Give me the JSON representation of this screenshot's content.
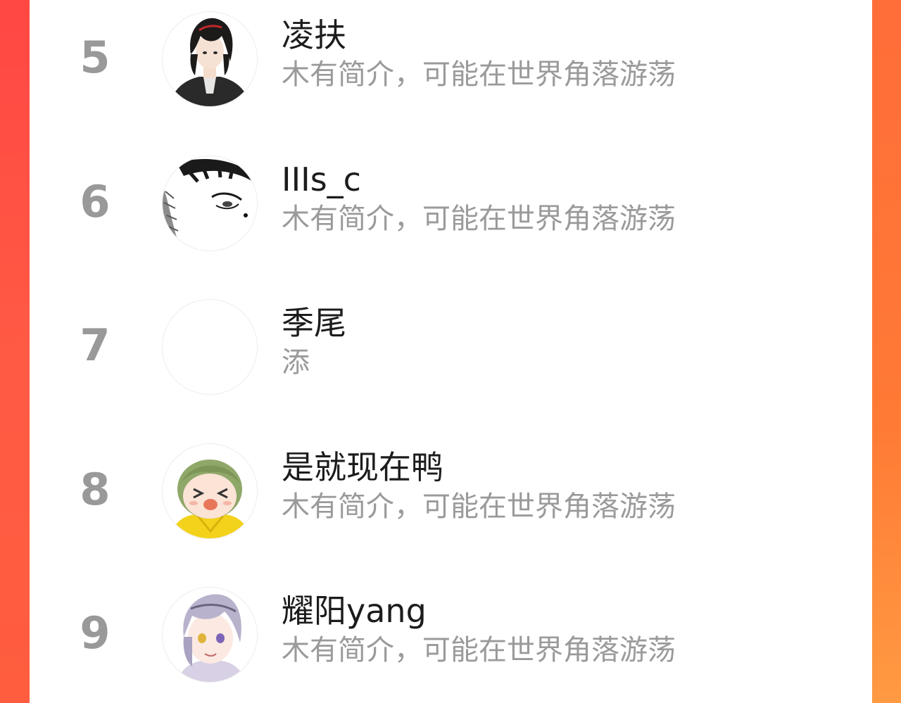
{
  "list": {
    "items": [
      {
        "rank": "5",
        "name": "凌扶",
        "bio": "木有简介，可能在世界角落游荡",
        "avatar_icon": "dark-haired-boy-avatar-icon"
      },
      {
        "rank": "6",
        "name": "IIIs_c",
        "bio": "木有简介，可能在世界角落游荡",
        "avatar_icon": "manga-eye-avatar-icon"
      },
      {
        "rank": "7",
        "name": "季尾",
        "bio": "添",
        "avatar_icon": "blank-avatar-icon"
      },
      {
        "rank": "8",
        "name": "是就现在鸭",
        "bio": "木有简介，可能在世界角落游荡",
        "avatar_icon": "green-hair-chibi-avatar-icon"
      },
      {
        "rank": "9",
        "name": "耀阳yang",
        "bio": "木有简介，可能在世界角落游荡",
        "avatar_icon": "silver-hair-boy-avatar-icon"
      }
    ]
  },
  "colors": {
    "background_gradient_start": "#ff4a4a",
    "background_gradient_end": "#ff7a35",
    "rank_text": "#999999",
    "name_text": "#1c1c1c",
    "bio_text": "#9a9a9a"
  }
}
